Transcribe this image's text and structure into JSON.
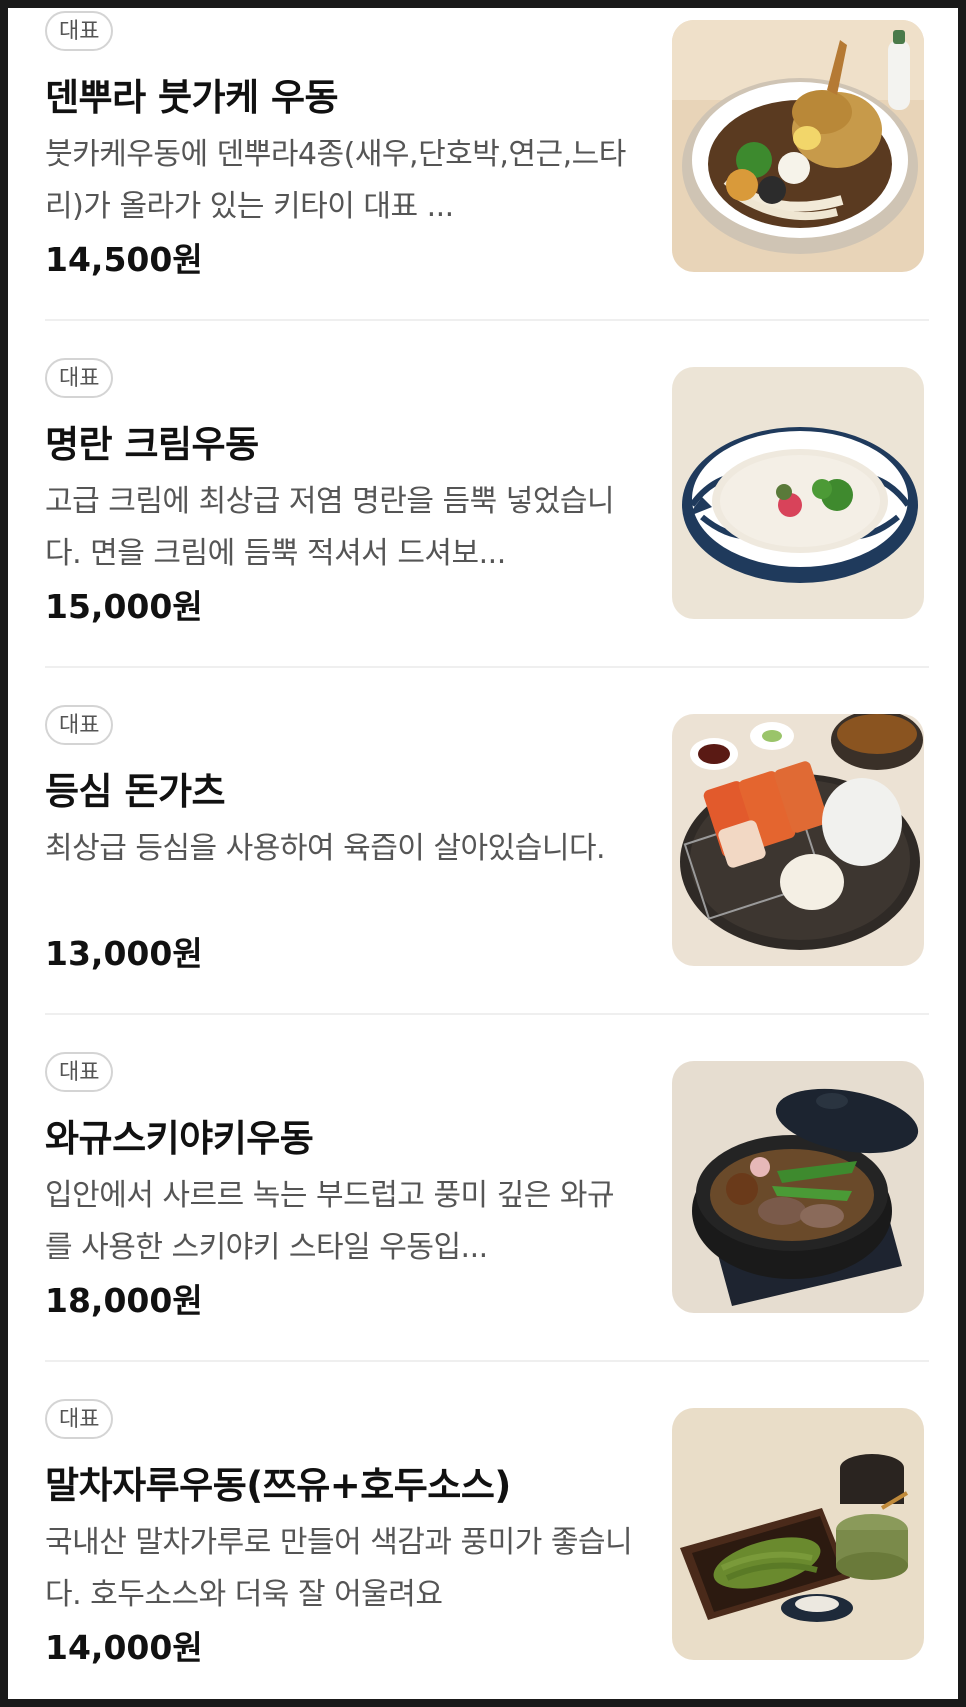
{
  "menu": {
    "items": [
      {
        "badge": "대표",
        "name": "덴뿌라 붓가케 우동",
        "description": "붓카케우동에 덴뿌라4종(새우,단호박,연근,느타리)가 올라가 있는 키타이 대표 ...",
        "price": "14,500원",
        "image_icon": "tempura-udon-photo"
      },
      {
        "badge": "대표",
        "name": "명란 크림우동",
        "description": "고급 크림에 최상급 저염 명란을 듬뿍 넣었습니다. 면을 크림에 듬뿍 적셔서 드셔보...",
        "price": "15,000원",
        "image_icon": "mentaiko-cream-udon-photo"
      },
      {
        "badge": "대표",
        "name": "등심 돈가츠",
        "description": "최상급 등심을 사용하여 육즙이 살아있습니다.",
        "price": "13,000원",
        "image_icon": "pork-loin-tonkatsu-photo"
      },
      {
        "badge": "대표",
        "name": "와규스키야키우동",
        "description": "입안에서 사르르 녹는 부드럽고 풍미 깊은 와규를 사용한 스키야키 스타일 우동입...",
        "price": "18,000원",
        "image_icon": "wagyu-sukiyaki-udon-photo"
      },
      {
        "badge": "대표",
        "name": "말차자루우동(쯔유+호두소스)",
        "description": "국내산 말차가루로 만들어 색감과 풍미가 좋습니다. 호두소스와 더욱 잘 어울려요",
        "price": "14,000원",
        "image_icon": "matcha-zaru-udon-photo"
      }
    ]
  }
}
